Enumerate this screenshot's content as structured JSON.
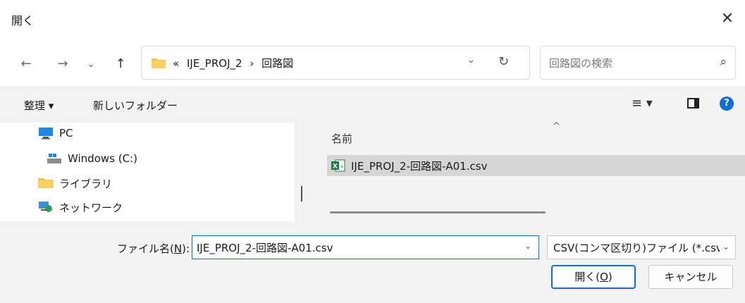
{
  "window": {
    "title": "開く",
    "close_symbol": "✕"
  },
  "nav": {
    "back_symbol": "←",
    "forward_symbol": "→",
    "recent_symbol": "⌄",
    "up_symbol": "↑",
    "path_prefix": "«",
    "path_segments": [
      "IJE_PROJ_2",
      "›",
      "回路図"
    ],
    "dropdown_symbol": "⌄",
    "refresh_symbol": "↻",
    "search_placeholder": "回路図の検索",
    "search_symbol": "⌕"
  },
  "toolbar": {
    "organize_label": "整理 ▾",
    "new_folder_label": "新しいフォルダー",
    "view_symbol": "≡ ▾",
    "help_symbol": "?"
  },
  "sidebar": {
    "items": [
      {
        "label": "PC",
        "icon": "pc-icon"
      },
      {
        "label": "Windows (C:)",
        "icon": "drive-icon"
      },
      {
        "label": "ライブラリ",
        "icon": "library-icon"
      },
      {
        "label": "ネットワーク",
        "icon": "network-icon"
      }
    ]
  },
  "filelist": {
    "column_name": "名前",
    "sort_symbol": "^",
    "files": [
      {
        "name": "IJE_PROJ_2-回路図-A01.csv",
        "icon": "excel-csv-icon",
        "selected": true
      }
    ]
  },
  "footer": {
    "filename_label_prefix": "ファイル名(",
    "filename_label_key": "N",
    "filename_label_suffix": "):",
    "filename_value": "IJE_PROJ_2-回路図-A01.csv",
    "filetype_value": "CSV(コンマ区切り)ファイル (*.csv",
    "dropdown_symbol": "⌄",
    "open_label_prefix": "開く(",
    "open_label_key": "O",
    "open_label_suffix": ")",
    "cancel_label": "キャンセル"
  },
  "colors": {
    "accent": "#0f6cd8",
    "selection": "#d6d6d6",
    "folder": "#f5c242",
    "excel": "#1d7a45"
  }
}
